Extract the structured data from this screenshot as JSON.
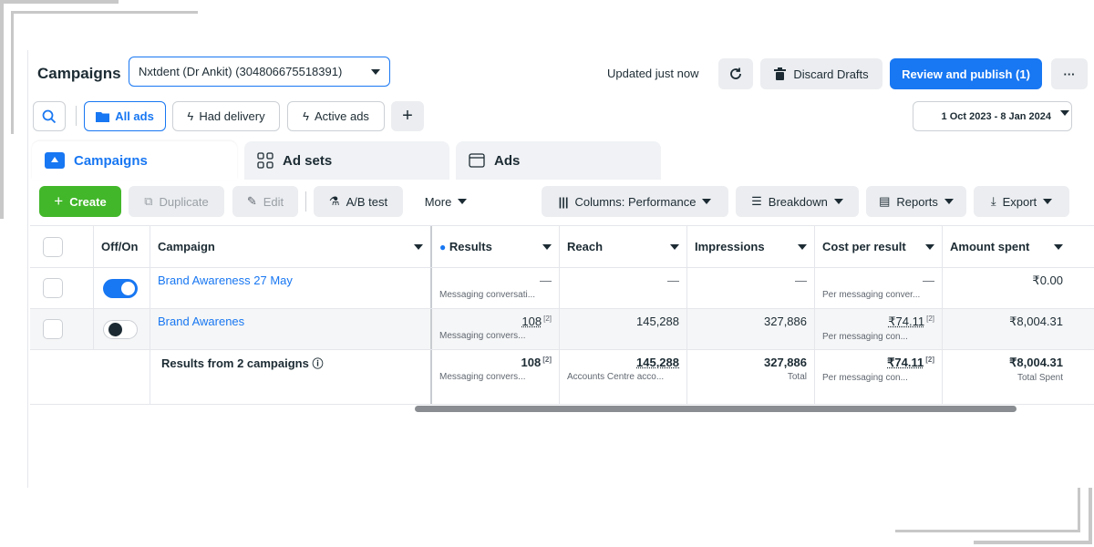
{
  "header": {
    "title": "Campaigns",
    "account": "Nxtdent (Dr Ankit) (304806675518391)",
    "updated": "Updated just now",
    "discard_label": "Discard Drafts",
    "publish_label": "Review and publish (1)",
    "more_label": "···"
  },
  "filters": {
    "all_ads": "All ads",
    "had_delivery": "Had delivery",
    "active_ads": "Active ads",
    "add": "+",
    "date_range": "1 Oct 2023 - 8 Jan 2024"
  },
  "tabs": [
    {
      "label": "Campaigns"
    },
    {
      "label": "Ad sets"
    },
    {
      "label": "Ads"
    }
  ],
  "toolbar": {
    "create": "Create",
    "duplicate": "Duplicate",
    "edit": "Edit",
    "ab_test": "A/B test",
    "more": "More",
    "columns": "Columns: Performance",
    "breakdown": "Breakdown",
    "reports": "Reports",
    "export": "Export"
  },
  "table": {
    "headers": {
      "offon": "Off/On",
      "campaign": "Campaign",
      "results": "Results",
      "reach": "Reach",
      "impressions": "Impressions",
      "cost": "Cost per result",
      "amount": "Amount spent"
    },
    "rows": [
      {
        "campaign": "Brand Awareness 27 May",
        "active": true,
        "results": "—",
        "results_sub": "Messaging conversati...",
        "reach": "—",
        "impressions": "—",
        "cost": "—",
        "cost_sub": "Per messaging conver...",
        "amount": "₹0.00"
      },
      {
        "campaign": "Brand Awarenes",
        "active": false,
        "results": "108",
        "results_fn": "[2]",
        "results_sub": "Messaging convers...",
        "reach": "145,288",
        "impressions": "327,886",
        "cost": "₹74.11",
        "cost_fn": "[2]",
        "cost_sub": "Per messaging con...",
        "amount": "₹8,004.31"
      }
    ],
    "summary": {
      "label": "Results from 2 campaigns",
      "results": "108",
      "results_fn": "[2]",
      "results_sub": "Messaging convers...",
      "reach": "145,288",
      "reach_sub": "Accounts Centre acco...",
      "impressions": "327,886",
      "impressions_sub": "Total",
      "cost": "₹74.11",
      "cost_fn": "[2]",
      "cost_sub": "Per messaging con...",
      "amount": "₹8,004.31",
      "amount_sub": "Total Spent"
    }
  },
  "colors": {
    "accent": "#1877f2",
    "create": "#42b72a"
  }
}
